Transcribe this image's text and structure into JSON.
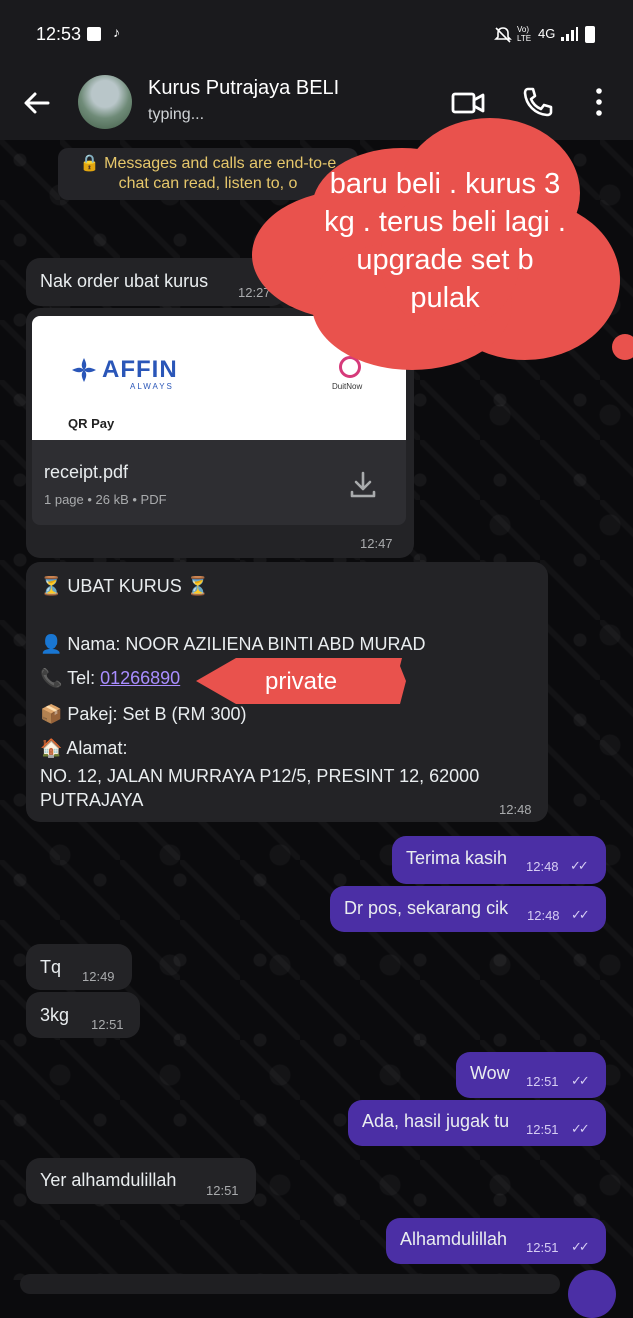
{
  "status_bar": {
    "time": "12:53",
    "network": "4G",
    "volte": "Vo) LTE",
    "icons": [
      "facebook-icon",
      "tiktok-icon",
      "mute-icon",
      "signal-icon",
      "battery-icon"
    ]
  },
  "header": {
    "name": "Kurus Putrajaya BELI",
    "status": "typing..."
  },
  "notice": {
    "line1": "🔒 Messages and calls are end-to-e",
    "line2": "chat can read, listen to, o"
  },
  "annotation": {
    "cloud_text": "baru beli . kurus 3 kg . terus beli lagi . upgrade set b pulak",
    "arrow_text": "private",
    "color": "#e9524d"
  },
  "messages": {
    "m1": {
      "text": "Nak order ubat kurus",
      "time": "12:27"
    },
    "receipt": {
      "bank": "AFFIN",
      "bank_sub": "ALWAYS",
      "qr": "QR Pay",
      "duitnow": "DuitNow",
      "filename": "receipt.pdf",
      "meta": "1 page • 26 kB • PDF",
      "time": "12:47"
    },
    "order": {
      "title": "⏳ UBAT KURUS ⏳",
      "nama": "👤 Nama: NOOR AZILIENA BINTI ABD MURAD",
      "tel_label": "📞 Tel: ",
      "tel_value": "01266890",
      "pakej": "📦 Pakej: Set B (RM 300)",
      "alamat": "🏠 Alamat:",
      "addr1": "NO. 12, JALAN MURRAYA P12/5, PRESINT 12, 62000",
      "addr2": "PUTRAJAYA",
      "time": "12:48"
    },
    "o1": {
      "text": "Terima kasih",
      "time": "12:48"
    },
    "o2": {
      "text": "Dr pos, sekarang cik",
      "time": "12:48"
    },
    "i1": {
      "text": "Tq",
      "time": "12:49"
    },
    "i2": {
      "text": "3kg",
      "time": "12:51"
    },
    "o3": {
      "text": "Wow",
      "time": "12:51"
    },
    "o4": {
      "text": "Ada, hasil jugak tu",
      "time": "12:51"
    },
    "i3": {
      "text": "Yer alhamdulillah",
      "time": "12:51"
    },
    "o5": {
      "text": "Alhamdulillah",
      "time": "12:51"
    }
  },
  "colors": {
    "outgoing": "#4b2fa5",
    "incoming": "#232326",
    "link": "#a98dff"
  }
}
